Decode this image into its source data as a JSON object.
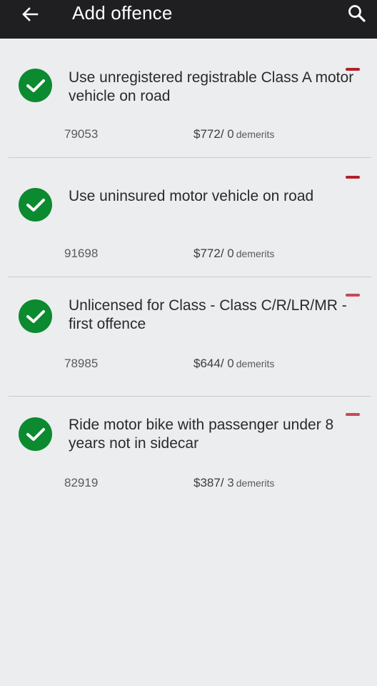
{
  "header": {
    "title": "Add offence",
    "back_icon": "arrow-left-icon",
    "search_icon": "search-icon"
  },
  "colors": {
    "appbar": "#1f1f21",
    "check": "#0b8a2f",
    "remove": "#b3202b",
    "background": "#ecedef"
  },
  "offences": [
    {
      "title": "Use unregistered registrable Class A motor vehicle on road",
      "code": "79053",
      "amount": "$772/",
      "demerits": "0",
      "demerits_label": "demerits"
    },
    {
      "title": "Use uninsured motor vehicle on road",
      "code": "91698",
      "amount": "$772/",
      "demerits": "0",
      "demerits_label": "demerits"
    },
    {
      "title": "Unlicensed for Class - Class C/R/LR/MR - first offence",
      "code": "78985",
      "amount": "$644/",
      "demerits": "0",
      "demerits_label": "demerits"
    },
    {
      "title": "Ride motor bike with passenger under 8 years not in sidecar",
      "code": "82919",
      "amount": "$387/",
      "demerits": "3",
      "demerits_label": "demerits"
    }
  ]
}
